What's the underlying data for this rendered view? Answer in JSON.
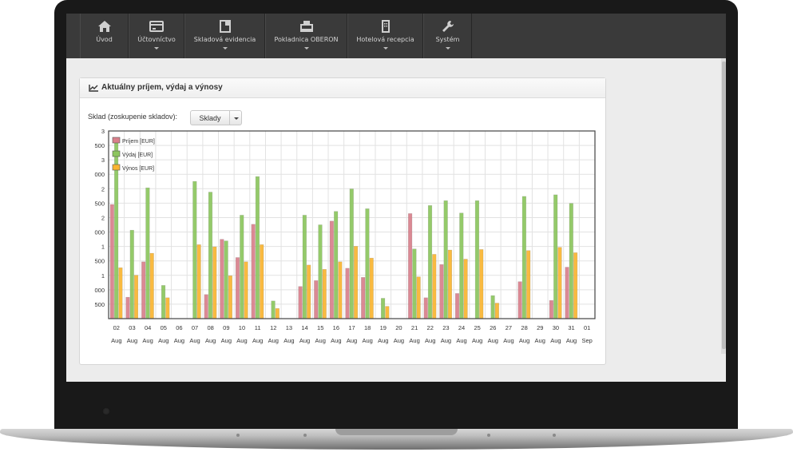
{
  "nav": {
    "items": [
      {
        "label": "Úvod",
        "icon": "home-icon",
        "has_menu": false
      },
      {
        "label": "Účtovníctvo",
        "icon": "accounting-icon",
        "has_menu": true
      },
      {
        "label": "Skladová evidencia",
        "icon": "inventory-icon",
        "has_menu": true
      },
      {
        "label": "Pokladnica OBERON",
        "icon": "cash-register-icon",
        "has_menu": true
      },
      {
        "label": "Hotelová recepcia",
        "icon": "hotel-icon",
        "has_menu": true
      },
      {
        "label": "Systém",
        "icon": "wrench-icon",
        "has_menu": true
      }
    ]
  },
  "panel": {
    "title": "Aktuálny príjem, výdaj a výnosy",
    "title_icon": "line-chart-icon",
    "filter_label": "Sklad (zoskupenie skladov):",
    "filter_value": "Sklady"
  },
  "chart_data": {
    "type": "bar",
    "y_tick_labels": [
      "3",
      "500",
      "3",
      "000",
      "2",
      "500",
      "2",
      "000",
      "1",
      "500",
      "1",
      "000",
      "500"
    ],
    "categories": [
      "02",
      "03",
      "04",
      "05",
      "06",
      "07",
      "08",
      "09",
      "10",
      "11",
      "12",
      "13",
      "14",
      "15",
      "16",
      "17",
      "18",
      "19",
      "20",
      "21",
      "22",
      "23",
      "24",
      "25",
      "26",
      "27",
      "28",
      "29",
      "30",
      "31",
      "01"
    ],
    "category_sublabels": [
      "Aug",
      "Aug",
      "Aug",
      "Aug",
      "Aug",
      "Aug",
      "Aug",
      "Aug",
      "Aug",
      "Aug",
      "Aug",
      "Aug",
      "Aug",
      "Aug",
      "Aug",
      "Aug",
      "Aug",
      "Aug",
      "Aug",
      "Aug",
      "Aug",
      "Aug",
      "Aug",
      "Aug",
      "Aug",
      "Aug",
      "Aug",
      "Aug",
      "Aug",
      "Aug",
      "Sep"
    ],
    "ylim": [
      0,
      3500
    ],
    "legend_position": "top-left",
    "grid": true,
    "series": [
      {
        "name": "Príjem [EUR]",
        "color": "#d9808b",
        "values": [
          2130,
          400,
          1060,
          0,
          0,
          0,
          450,
          1480,
          1140,
          1760,
          0,
          0,
          600,
          710,
          1820,
          940,
          770,
          0,
          0,
          1960,
          390,
          1010,
          470,
          0,
          0,
          0,
          690,
          0,
          340,
          960,
          0
        ]
      },
      {
        "name": "Výdaj [EUR]",
        "color": "#8cc65e",
        "values": [
          3300,
          1650,
          2440,
          620,
          0,
          2560,
          2360,
          1450,
          1930,
          2650,
          330,
          0,
          1930,
          1750,
          2000,
          2420,
          2050,
          380,
          0,
          1300,
          2110,
          2200,
          1970,
          2200,
          430,
          0,
          2280,
          0,
          2310,
          2150,
          0
        ]
      },
      {
        "name": "Výnos [EUR]",
        "color": "#f9b530",
        "values": [
          950,
          810,
          1220,
          390,
          0,
          1380,
          1340,
          800,
          1060,
          1380,
          190,
          0,
          1000,
          920,
          1060,
          1350,
          1130,
          230,
          0,
          780,
          1200,
          1280,
          1110,
          1290,
          290,
          0,
          1270,
          0,
          1330,
          1230,
          0
        ]
      }
    ]
  }
}
